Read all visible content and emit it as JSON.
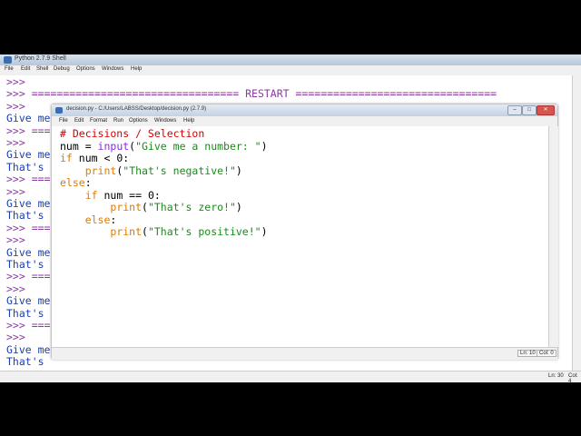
{
  "shell": {
    "title": "Python 2.7.9 Shell",
    "menu": [
      "File",
      "Edit",
      "Shell",
      "Debug",
      "Options",
      "Windows",
      "Help"
    ],
    "lines": [
      [
        {
          "t": ">>>",
          "c": "prompt"
        }
      ],
      [
        {
          "t": ">>> ",
          "c": "prompt"
        },
        {
          "t": "================================= RESTART ================================",
          "c": "restart"
        }
      ],
      [
        {
          "t": ">>>",
          "c": "prompt"
        }
      ],
      [
        {
          "t": "Give me",
          "c": "out"
        }
      ],
      [
        {
          "t": ">>> ===",
          "c": "prompt"
        }
      ],
      [
        {
          "t": ">>>",
          "c": "prompt"
        }
      ],
      [
        {
          "t": "Give me",
          "c": "out"
        }
      ],
      [
        {
          "t": "That's",
          "c": "out"
        }
      ],
      [
        {
          "t": ">>> ===",
          "c": "prompt"
        }
      ],
      [
        {
          "t": ">>>",
          "c": "prompt"
        }
      ],
      [
        {
          "t": "Give me",
          "c": "out"
        }
      ],
      [
        {
          "t": "That's",
          "c": "out"
        }
      ],
      [
        {
          "t": ">>> ===",
          "c": "prompt"
        }
      ],
      [
        {
          "t": ">>>",
          "c": "prompt"
        }
      ],
      [
        {
          "t": "Give me",
          "c": "out"
        }
      ],
      [
        {
          "t": "That's",
          "c": "out"
        }
      ],
      [
        {
          "t": ">>> ===",
          "c": "prompt"
        }
      ],
      [
        {
          "t": ">>>",
          "c": "prompt"
        }
      ],
      [
        {
          "t": "Give me",
          "c": "out"
        }
      ],
      [
        {
          "t": "That's",
          "c": "out"
        }
      ],
      [
        {
          "t": ">>> ===",
          "c": "prompt"
        }
      ],
      [
        {
          "t": ">>>",
          "c": "prompt"
        }
      ],
      [
        {
          "t": "Give me",
          "c": "out"
        }
      ],
      [
        {
          "t": "That's",
          "c": "out"
        }
      ],
      [
        {
          "t": ">>>",
          "c": "prompt"
        }
      ]
    ],
    "status_line": "Ln: 30",
    "status_col": "Col: 4"
  },
  "editor": {
    "title": "decision.py - C:/Users/LABSS/Desktop/decision.py (2.7.9)",
    "window_buttons": [
      "–",
      "□",
      "✕"
    ],
    "menu": [
      "File",
      "Edit",
      "Format",
      "Run",
      "Options",
      "Windows",
      "Help"
    ],
    "code": [
      [
        {
          "t": "# Decisions / Selection",
          "c": "comment"
        }
      ],
      [
        {
          "t": "num = ",
          "c": "plain"
        },
        {
          "t": "input",
          "c": "builtin"
        },
        {
          "t": "(",
          "c": "plain"
        },
        {
          "t": "\"Give me a number: \"",
          "c": "str"
        },
        {
          "t": ")",
          "c": "plain"
        }
      ],
      [
        {
          "t": "if",
          "c": "kw"
        },
        {
          "t": " num < 0:",
          "c": "plain"
        }
      ],
      [
        {
          "t": "    ",
          "c": "plain"
        },
        {
          "t": "print",
          "c": "kw"
        },
        {
          "t": "(",
          "c": "plain"
        },
        {
          "t": "\"That's negative!\"",
          "c": "str"
        },
        {
          "t": ")",
          "c": "plain"
        }
      ],
      [
        {
          "t": "else",
          "c": "kw"
        },
        {
          "t": ":",
          "c": "plain"
        }
      ],
      [
        {
          "t": "    ",
          "c": "plain"
        },
        {
          "t": "if",
          "c": "kw"
        },
        {
          "t": " num == 0:",
          "c": "plain"
        }
      ],
      [
        {
          "t": "        ",
          "c": "plain"
        },
        {
          "t": "print",
          "c": "kw"
        },
        {
          "t": "(",
          "c": "plain"
        },
        {
          "t": "\"That's zero!\"",
          "c": "str"
        },
        {
          "t": ")",
          "c": "plain"
        }
      ],
      [
        {
          "t": "    ",
          "c": "plain"
        },
        {
          "t": "else",
          "c": "kw"
        },
        {
          "t": ":",
          "c": "plain"
        }
      ],
      [
        {
          "t": "        ",
          "c": "plain"
        },
        {
          "t": "print",
          "c": "kw"
        },
        {
          "t": "(",
          "c": "plain"
        },
        {
          "t": "\"That's positive!\"",
          "c": "str"
        },
        {
          "t": ")",
          "c": "plain"
        }
      ]
    ],
    "status_line": "Ln: 10",
    "status_col": "Col: 0"
  },
  "colors": {
    "prompt": "#8a3aa0",
    "output": "#1a3fb0",
    "comment": "#d40000",
    "keyword": "#e07a00",
    "string": "#1e8a1e",
    "builtin": "#8a2be2"
  },
  "icons": [
    "python-shell-icon",
    "python-editor-icon"
  ]
}
